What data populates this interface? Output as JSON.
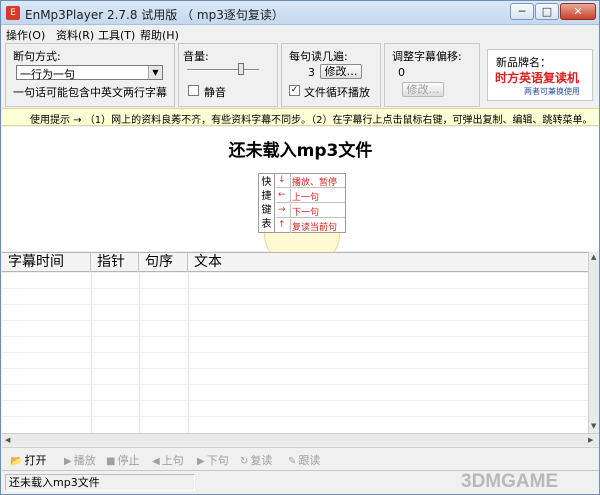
{
  "window": {
    "title": "EnMp3Player 2.7.8 试用版 （ mp3逐句复读）",
    "app_icon": "E",
    "min_glyph": "─",
    "max_glyph": "□",
    "close_glyph": "✕"
  },
  "menu": [
    {
      "label": "操作(O)"
    },
    {
      "label": "资料(R)"
    },
    {
      "label": "工具(T)"
    },
    {
      "label": "帮助(H)"
    }
  ],
  "sentence_panel": {
    "label": "断句方式:",
    "selected": "一行为一句",
    "note": "一句话可能包含中英文两行字幕"
  },
  "volume_panel": {
    "label": "音量:",
    "level": 0.75,
    "mute_label": "静音",
    "mute_checked": false
  },
  "repeat_panel": {
    "label": "每句读几遍:",
    "count": "3",
    "modify_label": "修改…",
    "loop_label": "文件循环播放",
    "loop_checked": true,
    "check_glyph": "✓"
  },
  "offset_panel": {
    "label": "调整字幕偏移:",
    "value": "0",
    "modify_label": "修改…"
  },
  "brand": {
    "title": "新品牌名：",
    "name": "时方英语复读机",
    "subtitle": "两者可兼换使用"
  },
  "tip": "使用提示 → （1）网上的资料良莠不齐，有些资料字幕不同步。（2）在字幕行上点击鼠标右键，可弹出复制、编辑、跳转菜单。",
  "main": {
    "heading": "还未载入mp3文件",
    "shortcut_title_chars": [
      "快",
      "捷",
      "键",
      "表"
    ],
    "shortcuts": [
      {
        "key": "↓",
        "action": "播放、暂停"
      },
      {
        "key": "←",
        "action": "上一句"
      },
      {
        "key": "→",
        "action": "下一句"
      },
      {
        "key": "↑",
        "action": "复读当前句"
      }
    ]
  },
  "grid": {
    "columns": [
      {
        "label": "字幕时间"
      },
      {
        "label": "指针"
      },
      {
        "label": "句序"
      },
      {
        "label": "文本"
      }
    ]
  },
  "toolbar": [
    {
      "icon": "📂",
      "label": "打开",
      "enabled": true
    },
    {
      "icon": "▶",
      "label": "播放",
      "enabled": false
    },
    {
      "icon": "■",
      "label": "停止",
      "enabled": false
    },
    {
      "icon": "◀",
      "label": "上句",
      "enabled": false
    },
    {
      "icon": "▶",
      "label": "下句",
      "enabled": false
    },
    {
      "icon": "↻",
      "label": "复读",
      "enabled": false
    },
    {
      "icon": "✎",
      "label": "跟读",
      "enabled": false
    }
  ],
  "status": "还未载入mp3文件",
  "watermark": "3DMGAME",
  "colors": {
    "tip_background": "#ffffd6",
    "brand_red": "#e02020",
    "shortcut_red": "#d22222"
  }
}
